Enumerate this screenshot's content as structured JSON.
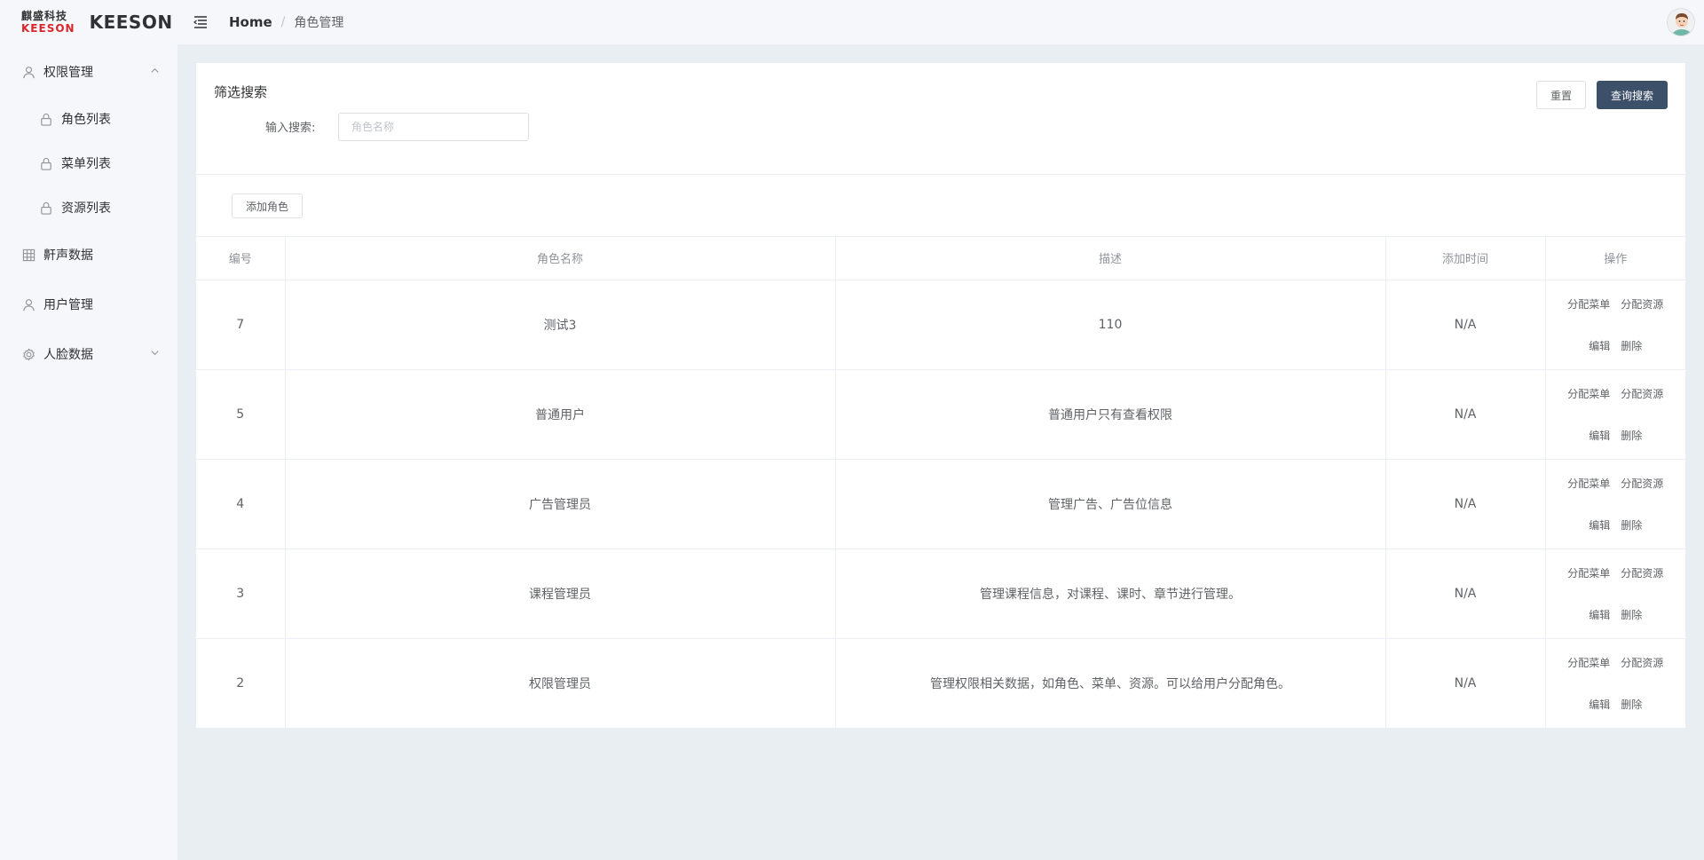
{
  "brand": {
    "cn": "麒盛科技",
    "en": "KEESON",
    "title": "KEESON"
  },
  "sidebar": {
    "items": [
      {
        "label": "权限管理",
        "expanded": true,
        "children": [
          {
            "label": "角色列表"
          },
          {
            "label": "菜单列表"
          },
          {
            "label": "资源列表"
          }
        ]
      },
      {
        "label": "鼾声数据"
      },
      {
        "label": "用户管理"
      },
      {
        "label": "人脸数据",
        "expanded": false
      }
    ]
  },
  "header": {
    "breadcrumb": {
      "home": "Home",
      "separator": "/",
      "current": "角色管理"
    }
  },
  "filter": {
    "title": "筛选搜索",
    "label": "输入搜索:",
    "placeholder": "角色名称",
    "value": "",
    "reset_label": "重置",
    "search_label": "查询搜索"
  },
  "toolbar": {
    "add_label": "添加角色"
  },
  "table": {
    "columns": [
      "编号",
      "角色名称",
      "描述",
      "添加时间",
      "操作"
    ],
    "rows": [
      {
        "id": "7",
        "name": "测试3",
        "desc": "110",
        "time": "N/A"
      },
      {
        "id": "5",
        "name": "普通用户",
        "desc": "普通用户只有查看权限",
        "time": "N/A"
      },
      {
        "id": "4",
        "name": "广告管理员",
        "desc": "管理广告、广告位信息",
        "time": "N/A"
      },
      {
        "id": "3",
        "name": "课程管理员",
        "desc": "管理课程信息，对课程、课时、章节进行管理。",
        "time": "N/A"
      },
      {
        "id": "2",
        "name": "权限管理员",
        "desc": "管理权限相关数据，如角色、菜单、资源。可以给用户分配角色。",
        "time": "N/A"
      }
    ],
    "actions": {
      "assign_menu": "分配菜单",
      "assign_resource": "分配资源",
      "edit": "编辑",
      "delete": "删除"
    }
  },
  "colors": {
    "primary_button": "#3d5069",
    "sidebar_bg": "#f5f7fa",
    "page_bg": "#e9eef3",
    "brand_red": "#d8262c"
  }
}
